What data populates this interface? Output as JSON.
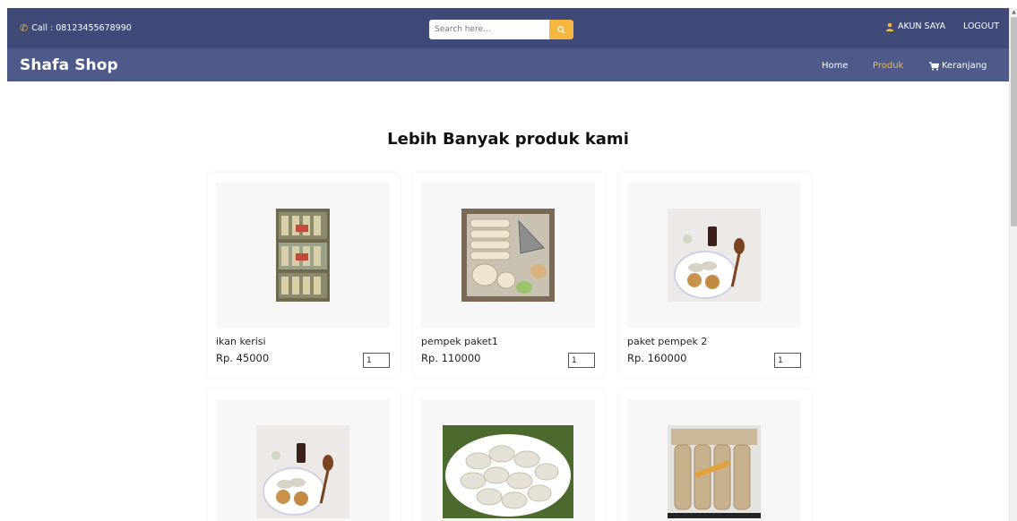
{
  "topbar": {
    "call_text": "Call : 08123455678990",
    "search_placeholder": "Search here...",
    "account_label": "AKUN SAYA",
    "logout_label": "LOGOUT"
  },
  "navbar": {
    "brand": "Shafa Shop",
    "links": [
      {
        "label": "Home"
      },
      {
        "label": "Produk"
      },
      {
        "label": "Keranjang"
      }
    ]
  },
  "main": {
    "heading": "Lebih Banyak produk kami"
  },
  "products": [
    {
      "name": "ikan kerisi",
      "price": "Rp. 45000",
      "qty": "1"
    },
    {
      "name": "pempek paket1",
      "price": "Rp. 110000",
      "qty": "1"
    },
    {
      "name": "paket pempek 2",
      "price": "Rp. 160000",
      "qty": "1"
    },
    {
      "name": "",
      "price": "",
      "qty": ""
    },
    {
      "name": "",
      "price": "",
      "qty": ""
    },
    {
      "name": "",
      "price": "",
      "qty": ""
    }
  ],
  "colors": {
    "topbar": "#3f4a78",
    "navbar": "#4d5a8a",
    "accent": "#f5b73f"
  },
  "icons": [
    "phone-icon",
    "search-icon",
    "user-icon",
    "cart-icon"
  ]
}
